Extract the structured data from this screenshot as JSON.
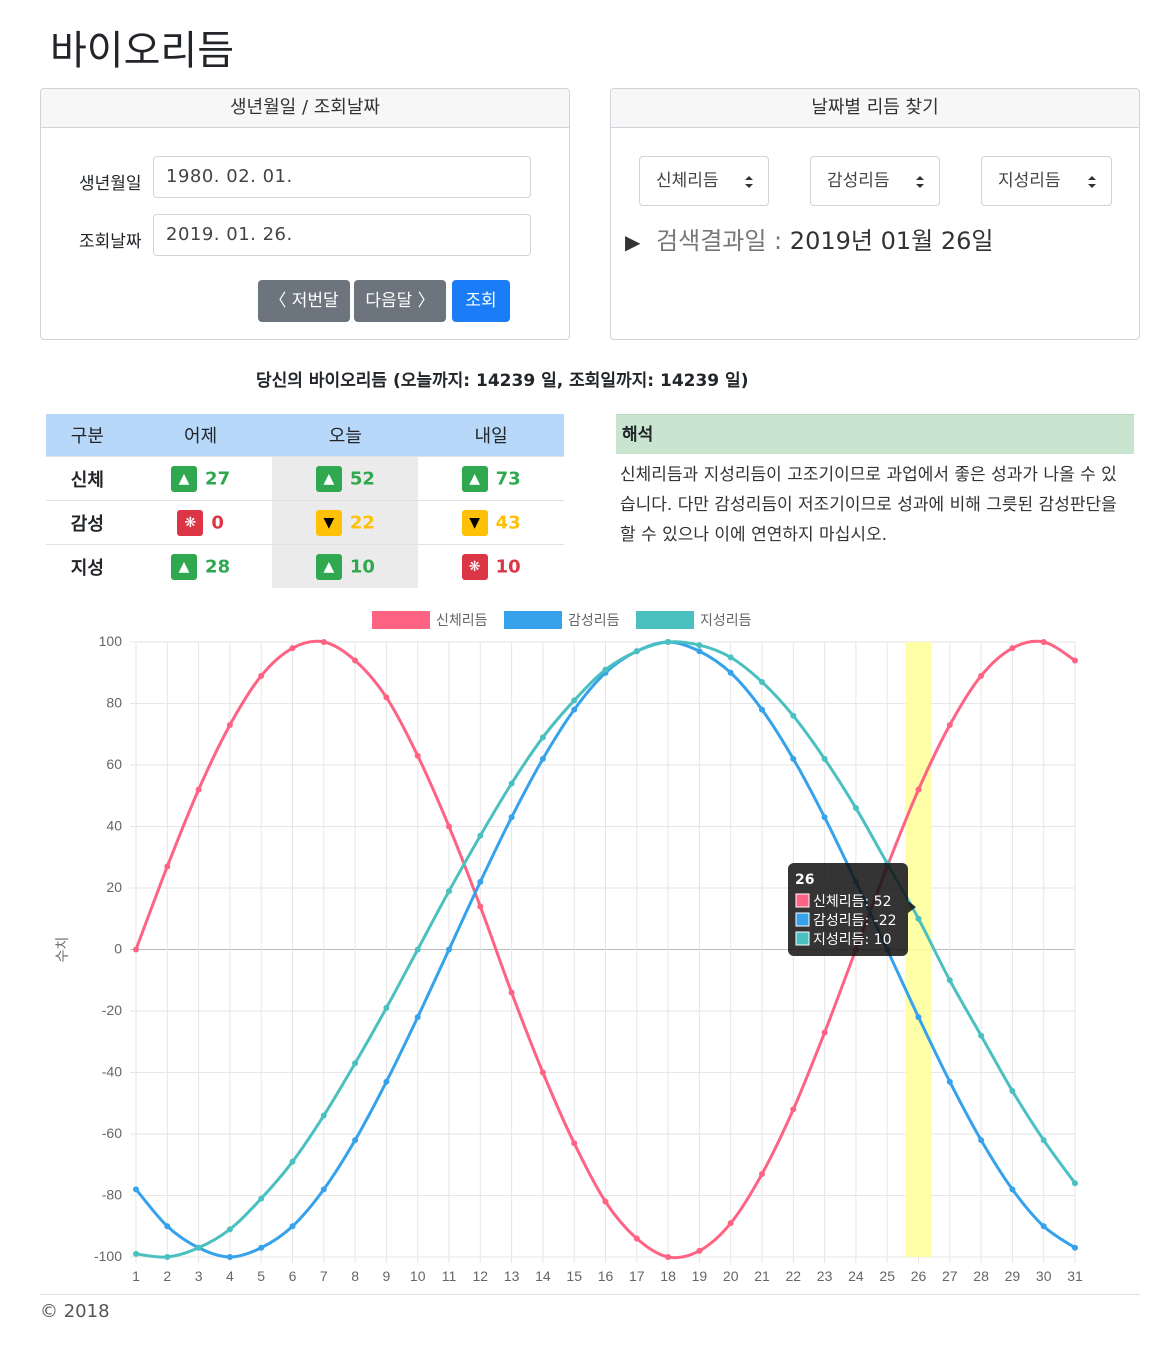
{
  "page": {
    "title": "바이오리듬"
  },
  "dates_card": {
    "header": "생년월일 / 조회날짜",
    "birth_label": "생년월일",
    "birth_value": "1980. 02. 01.",
    "query_label": "조회날짜",
    "query_value": "2019. 01. 26.",
    "prev_button": "〈 저번달",
    "next_button": "다음달 〉",
    "search_button": "조회"
  },
  "find_card": {
    "header": "날짜별 리듬 찾기",
    "selects": [
      "신체리듬",
      "감성리듬",
      "지성리듬"
    ],
    "result_prefix": "▶",
    "result_label": "검색결과일 :",
    "result_value": "2019년 01월 26일"
  },
  "summary": "당신의 바이오리듬 (오늘까지: 14239 일, 조회일까지: 14239 일)",
  "rhythm_table": {
    "headers": [
      "구분",
      "어제",
      "오늘",
      "내일"
    ],
    "rows": [
      {
        "name": "신체",
        "cells": [
          {
            "icon": "▲",
            "state": "up",
            "value": "27"
          },
          {
            "icon": "▲",
            "state": "up",
            "value": "52"
          },
          {
            "icon": "▲",
            "state": "up",
            "value": "73"
          }
        ]
      },
      {
        "name": "감성",
        "cells": [
          {
            "icon": "❋",
            "state": "critical",
            "value": "0"
          },
          {
            "icon": "▼",
            "state": "down",
            "value": "22"
          },
          {
            "icon": "▼",
            "state": "down",
            "value": "43"
          }
        ]
      },
      {
        "name": "지성",
        "cells": [
          {
            "icon": "▲",
            "state": "up",
            "value": "28"
          },
          {
            "icon": "▲",
            "state": "up",
            "value": "10"
          },
          {
            "icon": "❋",
            "state": "critical",
            "value": "10"
          }
        ]
      }
    ]
  },
  "interpretation": {
    "header": "해석",
    "text": "신체리듬과 지성리듬이 고조기이므로 과업에서 좋은 성과가 나올 수 있습니다. 다만 감성리듬이 저조기이므로 성과에 비해 그릇된 감성판단을 할 수 있으나 이에 연연하지 마십시오."
  },
  "colors": {
    "physical": "#ff6384",
    "emotional": "#36a2eb",
    "intellectual": "#4bc0c0",
    "highlight": "#ffff99"
  },
  "chart_data": {
    "type": "line",
    "ylabel": "수치",
    "ylim": [
      -100,
      100
    ],
    "yticks": [
      100,
      80,
      60,
      40,
      20,
      0,
      -20,
      -40,
      -60,
      -80,
      -100
    ],
    "x": [
      1,
      2,
      3,
      4,
      5,
      6,
      7,
      8,
      9,
      10,
      11,
      12,
      13,
      14,
      15,
      16,
      17,
      18,
      19,
      20,
      21,
      22,
      23,
      24,
      25,
      26,
      27,
      28,
      29,
      30,
      31
    ],
    "highlight_x": 26,
    "grid": true,
    "legend_position": "top",
    "series": [
      {
        "name": "신체리듬",
        "values": [
          0,
          27,
          52,
          73,
          89,
          98,
          100,
          94,
          82,
          63,
          40,
          14,
          -14,
          -40,
          -63,
          -82,
          -94,
          -100,
          -98,
          -89,
          -73,
          -52,
          -27,
          0,
          27,
          52,
          73,
          89,
          98,
          100,
          94
        ]
      },
      {
        "name": "감성리듬",
        "values": [
          -78,
          -90,
          -97,
          -100,
          -97,
          -90,
          -78,
          -62,
          -43,
          -22,
          0,
          22,
          43,
          62,
          78,
          90,
          97,
          100,
          97,
          90,
          78,
          62,
          43,
          22,
          0,
          -22,
          -43,
          -62,
          -78,
          -90,
          -97
        ]
      },
      {
        "name": "지성리듬",
        "values": [
          -99,
          -100,
          -97,
          -91,
          -81,
          -69,
          -54,
          -37,
          -19,
          0,
          19,
          37,
          54,
          69,
          81,
          91,
          97,
          100,
          99,
          95,
          87,
          76,
          62,
          46,
          28,
          10,
          -10,
          -28,
          -46,
          -62,
          -76
        ]
      }
    ],
    "tooltip": {
      "title": "26",
      "lines": [
        "신체리듬: 52",
        "감성리듬: -22",
        "지성리듬: 10"
      ]
    }
  },
  "footer": "© 2018"
}
